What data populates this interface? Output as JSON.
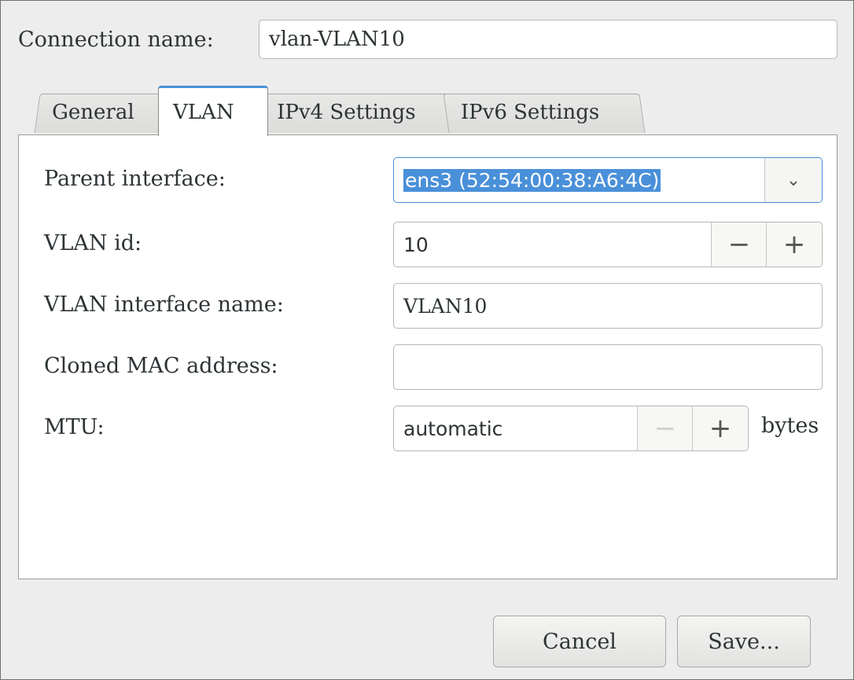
{
  "connection": {
    "label": "Connection name:",
    "value": "vlan-VLAN10"
  },
  "tabs": [
    {
      "label": "General"
    },
    {
      "label": "VLAN"
    },
    {
      "label": "IPv4 Settings"
    },
    {
      "label": "IPv6 Settings"
    }
  ],
  "active_tab": "VLAN",
  "form": {
    "parent_interface": {
      "label": "Parent interface:",
      "value": "ens3 (52:54:00:38:A6:4C)"
    },
    "vlan_id": {
      "label": "VLAN id:",
      "value": "10"
    },
    "vlan_interface_name": {
      "label": "VLAN interface name:",
      "value": "VLAN10"
    },
    "cloned_mac": {
      "label": "Cloned MAC address:",
      "value": ""
    },
    "mtu": {
      "label": "MTU:",
      "value": "automatic",
      "unit": "bytes"
    }
  },
  "icons": {
    "dropdown": "⌄",
    "minus": "−",
    "plus": "+"
  },
  "buttons": {
    "cancel": "Cancel",
    "save": "Save..."
  },
  "colors": {
    "accent": "#4a90d9",
    "background": "#ededed"
  }
}
